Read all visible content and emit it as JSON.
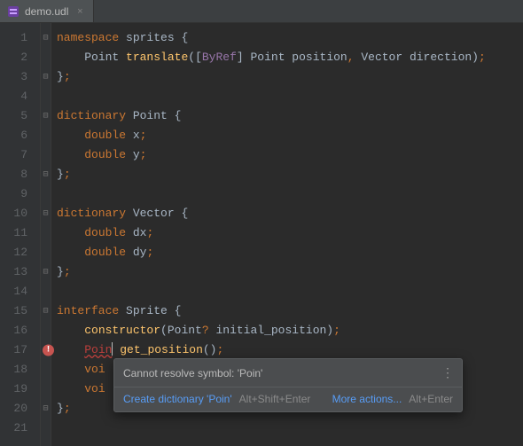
{
  "tab": {
    "filename": "demo.udl",
    "close_glyph": "×"
  },
  "foldmarks": [
    "⊟",
    "",
    "⊟",
    "",
    "⊟",
    "",
    "",
    "⊟",
    "",
    "⊟",
    "",
    "",
    "⊟",
    "",
    "⊟",
    "",
    "",
    "",
    "",
    "⊟",
    ""
  ],
  "line_numbers": [
    "1",
    "2",
    "3",
    "4",
    "5",
    "6",
    "7",
    "8",
    "9",
    "10",
    "11",
    "12",
    "13",
    "14",
    "15",
    "16",
    "17",
    "18",
    "19",
    "20",
    "21"
  ],
  "error_line_index": 16,
  "code": {
    "l1": {
      "a": "namespace ",
      "b": "sprites ",
      "c": "{"
    },
    "l2": {
      "pad": "    ",
      "a": "Point ",
      "fn": "translate",
      "b": "(",
      "c": "[",
      "d": "ByRef",
      "e": "]",
      "f": " Point position",
      "g": ",",
      "h": " Vector direction)",
      "i": ";"
    },
    "l3": {
      "a": "}",
      "b": ";"
    },
    "l5": {
      "a": "dictionary ",
      "b": "Point ",
      "c": "{"
    },
    "l6": {
      "pad": "    ",
      "a": "double ",
      "b": "x",
      "c": ";"
    },
    "l7": {
      "pad": "    ",
      "a": "double ",
      "b": "y",
      "c": ";"
    },
    "l8": {
      "a": "}",
      "b": ";"
    },
    "l10": {
      "a": "dictionary ",
      "b": "Vector ",
      "c": "{"
    },
    "l11": {
      "pad": "    ",
      "a": "double ",
      "b": "dx",
      "c": ";"
    },
    "l12": {
      "pad": "    ",
      "a": "double ",
      "b": "dy",
      "c": ";"
    },
    "l13": {
      "a": "}",
      "b": ";"
    },
    "l15": {
      "a": "interface ",
      "b": "Sprite ",
      "c": "{"
    },
    "l16": {
      "pad": "    ",
      "a": "constructor",
      "b": "(Point",
      "c": "?",
      "d": " initial_position)",
      "e": ";"
    },
    "l17": {
      "pad": "    ",
      "err": "Poin",
      "sp": " ",
      "fn": "get_position",
      "b": "()",
      "c": ";"
    },
    "l18": {
      "pad": "    ",
      "a": "voi"
    },
    "l19": {
      "pad": "    ",
      "a": "voi"
    },
    "l20": {
      "a": "}",
      "b": ";"
    }
  },
  "popup": {
    "message": "Cannot resolve symbol: 'Poin'",
    "more_glyph": "⋮",
    "quickfix_label": "Create dictionary 'Poin'",
    "quickfix_shortcut": "Alt+Shift+Enter",
    "more_actions_label": "More actions...",
    "more_actions_shortcut": "Alt+Enter"
  }
}
